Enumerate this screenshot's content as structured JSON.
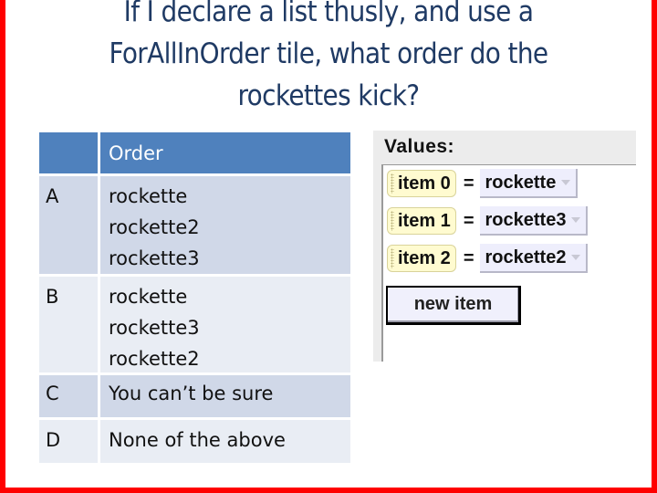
{
  "slide": {
    "title_lines": [
      "If I declare a list thusly, and use a",
      "ForAllInOrder tile, what order do the",
      "rockettes kick?"
    ],
    "frame_color": "#ff0000",
    "title_color": "#1f3a64"
  },
  "table": {
    "header": {
      "letter": "",
      "order": "Order"
    },
    "header_color": "#4f81bd",
    "rows": [
      {
        "letter": "A",
        "order": [
          "rockette",
          "rockette2",
          "rockette3"
        ]
      },
      {
        "letter": "B",
        "order": [
          "rockette",
          "rockette3",
          "rockette2"
        ]
      },
      {
        "letter": "C",
        "order": [
          "You can’t  be sure"
        ]
      },
      {
        "letter": "D",
        "order": [
          "None of the above"
        ]
      }
    ]
  },
  "values_panel": {
    "title": "Values:",
    "items": [
      {
        "label": "item 0",
        "equals": "=",
        "value": "rockette",
        "icon": "dropdown-arrow-icon"
      },
      {
        "label": "item 1",
        "equals": "=",
        "value": "rockette3",
        "icon": "dropdown-arrow-icon"
      },
      {
        "label": "item 2",
        "equals": "=",
        "value": "rockette2",
        "icon": "dropdown-arrow-icon"
      }
    ],
    "new_item_label": "new item",
    "tile_color": "#fffbd0",
    "value_color": "#eeeefc"
  }
}
